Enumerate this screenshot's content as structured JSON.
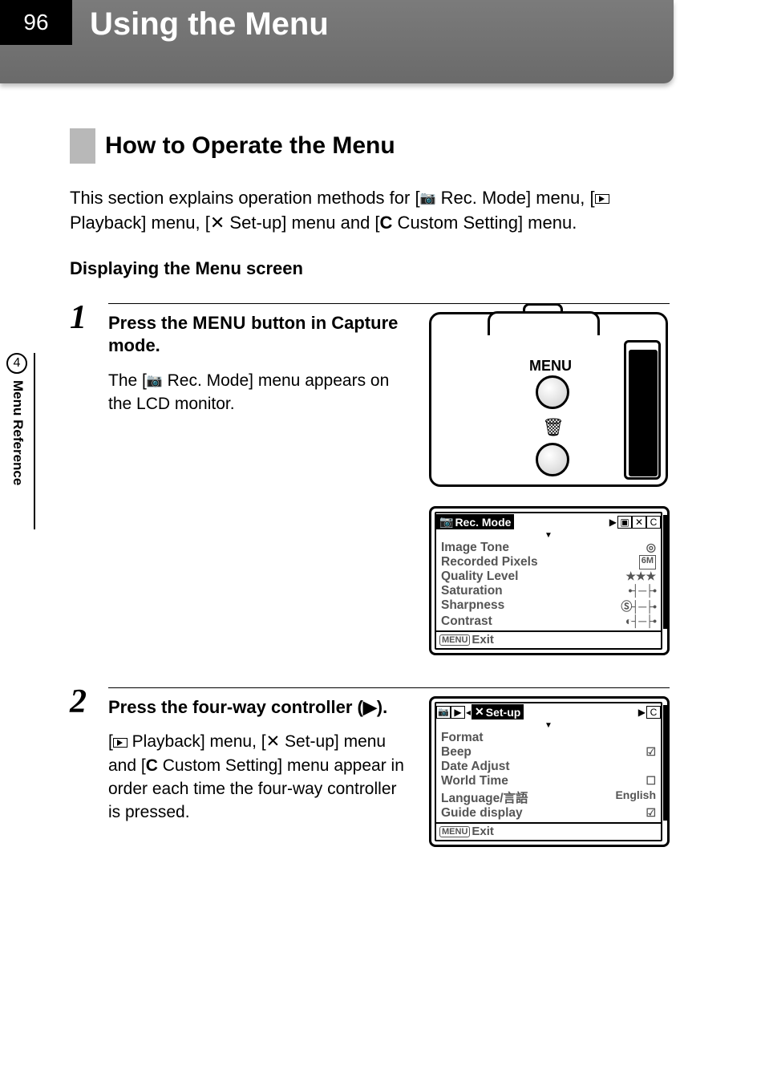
{
  "page_number": "96",
  "page_title": "Using the Menu",
  "side_tab": {
    "number": "4",
    "label": "Menu Reference"
  },
  "section": {
    "title": "How to Operate the Menu",
    "intro_pre": "This section explains operation methods for [",
    "intro_rec": " Rec. Mode] menu, [",
    "intro_play": " Playback] menu, [",
    "intro_setup": " Set-up] menu and [",
    "intro_custom_prefix": "C",
    "intro_custom": " Custom Setting] menu.",
    "subheading": "Displaying the Menu screen"
  },
  "steps": [
    {
      "num": "1",
      "heading_pre": "Press the ",
      "heading_menu": "MENU",
      "heading_post": " button in Capture mode.",
      "desc_pre": "The [",
      "desc_post": " Rec. Mode] menu appears on the LCD monitor."
    },
    {
      "num": "2",
      "heading": "Press the four-way controller (▶).",
      "desc_pre": "[",
      "desc_play": " Playback] menu, [",
      "desc_setup": " Set-up] menu and [",
      "desc_c": "C",
      "desc_custom": " Custom Setting] menu appear in order each time the four-way controller is pressed."
    }
  ],
  "camera": {
    "menu_label": "MENU"
  },
  "lcd1": {
    "tab_active": "Rec. Mode",
    "tab_right_icons": [
      "▶",
      "▣",
      "✕",
      "C"
    ],
    "items": [
      {
        "label": "Image Tone",
        "value": "◎"
      },
      {
        "label": "Recorded Pixels",
        "value": "6M"
      },
      {
        "label": "Quality Level",
        "value": "★★★"
      },
      {
        "label": "Saturation",
        "value": "•┤─├•"
      },
      {
        "label": "Sharpness",
        "value": "Ⓢ┤─├•"
      },
      {
        "label": "Contrast",
        "value": "◐┤─├•"
      }
    ],
    "footer_menu": "MENU",
    "footer_label": "Exit"
  },
  "lcd2": {
    "tab_left_icons": [
      "▣",
      "▶",
      "◂"
    ],
    "tab_active": " Set-up",
    "tab_right_icons": [
      "▶",
      "C"
    ],
    "items": [
      {
        "label": "Format",
        "value": ""
      },
      {
        "label": "Beep",
        "value": "☑"
      },
      {
        "label": "Date Adjust",
        "value": ""
      },
      {
        "label": "World Time",
        "value": "☐"
      },
      {
        "label": "Language/言語",
        "value": "English"
      },
      {
        "label": "Guide display",
        "value": "☑"
      }
    ],
    "footer_menu": "MENU",
    "footer_label": "Exit"
  }
}
